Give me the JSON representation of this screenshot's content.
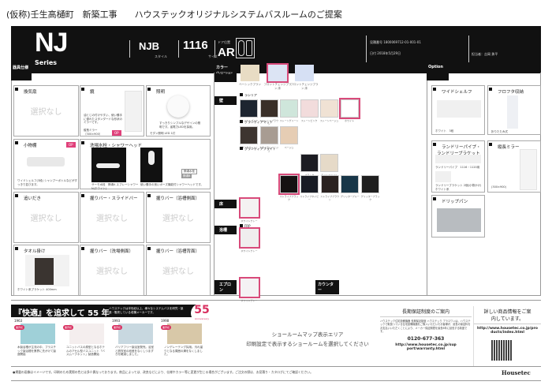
{
  "title": "(仮称)壬生高樋町　新築工事　　ハウステックオリジナルシステムバスルームのご提案",
  "header": {
    "series": "NJ",
    "series_sub": "Series",
    "style": "NJB",
    "style_label": "スタイル",
    "size": "1116",
    "size_label": "サイズ",
    "door_label": "ドア位置",
    "door": "AR",
    "estimate_no": "見積番号 1800069712-01-001-01",
    "date": "日付 2018年5月29日",
    "person": "担当者：吉岡 勇平"
  },
  "sections": {
    "fixtures": "器具仕様",
    "color": "カラー",
    "color_sub": "バリエーション",
    "option": "Option"
  },
  "none_text": "選択なし",
  "fixtures": [
    {
      "title": "換気扇"
    },
    {
      "title": "鏡",
      "desc": "油とじの付けやすい、使い勝手に優れたスタンダードな形状のミラーです。",
      "spec": "縦長ミラー（300×900）",
      "badge": "OP"
    },
    {
      "title": "照明",
      "desc": "すっきりシンプルなデザインの照明です。省電力LEDを採用。",
      "spec": "モダン照明 LED 1灯"
    },
    {
      "title": "小物棚",
      "desc": "ワイドシェルフ(3段) シャンプーボトルなどがすっきり並びます。",
      "badge": "OP"
    },
    {
      "title": "洗場水栓・シャワーヘッド",
      "desc": "サーモ水栓　節湯A スプレーシャワーN(ホワイト)",
      "desc2": "使い勝手の良いポーズ機能付シャワーヘッドです。",
      "tag1": "節湯水栓",
      "tag2": "節湯B"
    },
    {
      "title": "追いだき"
    },
    {
      "title": "握りバー・スライドバー"
    },
    {
      "title": "握りバー（浴槽側面）"
    },
    {
      "title": "タオル掛け",
      "desc": "ホワイト系ブラケット 400mm"
    },
    {
      "title": "握りバー（洗場側面）"
    },
    {
      "title": "握りバー（浴槽背面）"
    }
  ],
  "color": {
    "plans": [
      {
        "label": "ベーシックプラン",
        "color": "#e8dcc4"
      },
      {
        "label": "フロントチェンジプラン 床",
        "color": "#dce4f4"
      },
      {
        "label": "フロントチェンジプラン 床",
        "color": "#d6e0f4"
      }
    ],
    "wall_label": "壁",
    "floor_label": "床",
    "tub_label": "浴槽",
    "apron_label": "エプロン",
    "counter_label": "カウンター",
    "groups": [
      {
        "name": "ラシリア",
        "swatches": [
          {
            "label": "ストレートブルー",
            "color": "#1d2530"
          },
          {
            "label": "ストレートブラウン",
            "color": "#3a2f28"
          },
          {
            "label": "ストーングリーン",
            "color": "#cfe6db"
          },
          {
            "label": "ストーンピンク",
            "color": "#f2dcdc"
          },
          {
            "label": "ストーンベージュ",
            "color": "#f0e2d4"
          },
          {
            "label": "ホワイト",
            "color": "#ffffff",
            "selected": true
          }
        ]
      },
      {
        "name": "グランディアマット",
        "swatches": [
          {
            "label": "ダークウッド",
            "color": "#3d3530"
          },
          {
            "label": "ナチュラルベージュ",
            "color": "#a89c92"
          },
          {
            "label": "ベージュ",
            "color": "#e6cdb4"
          }
        ]
      },
      {
        "name": "グランディアブライト",
        "swatches": [
          {
            "label": "ブラック",
            "color": "#1c1c22"
          },
          {
            "label": "ライトベージュ",
            "color": "#e6dac8"
          },
          {
            "label": "ストライプブラック",
            "color": "#151212",
            "selected": true
          },
          {
            "label": "ストライプネイビー",
            "color": "#181c24"
          },
          {
            "label": "ストライプブラウン",
            "color": "#2a2220"
          },
          {
            "label": "グリッターブルー",
            "color": "#183648"
          },
          {
            "label": "グリッターブラック",
            "color": "#1e1e1e"
          }
        ]
      }
    ],
    "floor": {
      "label": "ホワイトグレー",
      "color": "#f4f2f2"
    },
    "tub_sub": "FRP",
    "tub": {
      "label": "ホワイトグレー",
      "color": "#f0eeee"
    },
    "apron": {
      "label": "ホワイトグレー",
      "color": "#f4f2f4"
    }
  },
  "options": [
    {
      "title": "ワイドシェルフ",
      "spec": "ホワイト　3段"
    },
    {
      "title": "フロフタ収納",
      "spec": "折りたたみ式"
    },
    {
      "title": "ランドリーパイプ・ランドリーブラケット",
      "spec": "ランドリーパイプ　1116・1120用",
      "spec2": "ランドリーブラケット 2個(小物かけ)ホワイト系"
    },
    {
      "title": "縦長ミラー",
      "spec": "(300×900)"
    },
    {
      "title": "ドリップパン"
    }
  ],
  "banner": {
    "headline": "『快適』を追求して 55 年",
    "sub": "ハウステックは半世紀以上、様々なシステムバスを研究・製造・販売している老舗メーカーです。",
    "badge": "55",
    "badge_sub": "Anniversary",
    "tag": "業界初",
    "items": [
      {
        "year": "1963",
        "text": "木製浴槽が主流の中、プラスチック製浴槽を業界に先がけて製造開始"
      },
      {
        "year": "",
        "text": "ユニットバスの原型となるホテルのアセル型バスユニット「バスムーブネット」製造開始"
      },
      {
        "year": "1993",
        "text": "バリアフリー製浴室発売。浴室と脱衣室の段差をなくしつまずきを軽減しました。"
      },
      {
        "year": "1998",
        "text": "ノンデレーテング採用。汚れ溜りとなる周囲の溝をなくしました。"
      }
    ]
  },
  "showroom": {
    "line1": "ショールームマップ表示エリア",
    "line2": "印刷設定で表示するショールームを選択してください"
  },
  "warranty": {
    "title": "長期保証制度のご案内",
    "text": "ハウステック住宅設備機器 長期保証制度 ハウステック プラスワンは、ハウステックで取扱っている住宅設備機器をご購入いただいたお客様が、延長の保証料をお支払いいただくことにより、メーカー保証期間を最長6年に延長する制度です。",
    "phone": "0120-677-363",
    "url": "http://www.housetec.co.jp/support/warranty.html"
  },
  "info": {
    "title": "詳しい商品情報をご案内しています。",
    "url": "http://www.housetec.co.jp/products/index.html"
  },
  "brand": "Housetec",
  "footnote": "●掲載の画像はイメージです。印刷のため実際の色とは多少異なっております。商品によっては、改良などにより、仕様やカラー等に変更が生じる場合がございます。ご注文の際は、お見積り・カタログにてご確認ください。"
}
